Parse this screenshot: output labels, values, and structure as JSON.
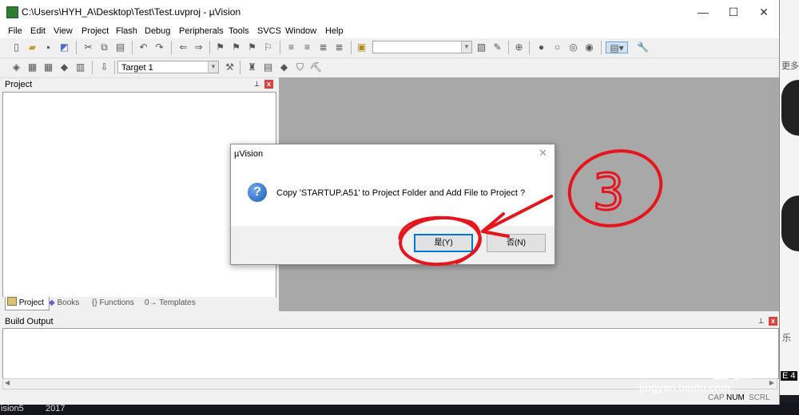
{
  "window": {
    "title": "C:\\Users\\HYH_A\\Desktop\\Test\\Test.uvproj - µVision",
    "controls": {
      "minimize": "—",
      "maximize": "☐",
      "close": "✕"
    }
  },
  "menu": [
    "File",
    "Edit",
    "View",
    "Project",
    "Flash",
    "Debug",
    "Peripherals",
    "Tools",
    "SVCS",
    "Window",
    "Help"
  ],
  "toolbar": {
    "target": "Target 1"
  },
  "project_panel": {
    "title": "Project",
    "tabs": [
      "Project",
      "Books",
      "{} Functions",
      "0→ Templates"
    ]
  },
  "build_output": {
    "title": "Build Output"
  },
  "status": {
    "cap": "CAP",
    "num": "NUM",
    "scrl": "SCRL"
  },
  "dialog": {
    "title": "µVision",
    "message": "Copy 'STARTUP.A51' to Project Folder and Add File to Project ?",
    "yes_label": "是(Y)",
    "no_label": "否(N)"
  },
  "annotation": {
    "number": "3",
    "color": "#e8141c"
  },
  "background": {
    "side_texts": [
      "更多",
      "乐"
    ],
    "bottom_left": "ision5",
    "bottom_year": "2017",
    "right_text": "E 4"
  },
  "watermark": {
    "brand": "Bai  du 经验",
    "url": "jingyan.baidu.com"
  }
}
